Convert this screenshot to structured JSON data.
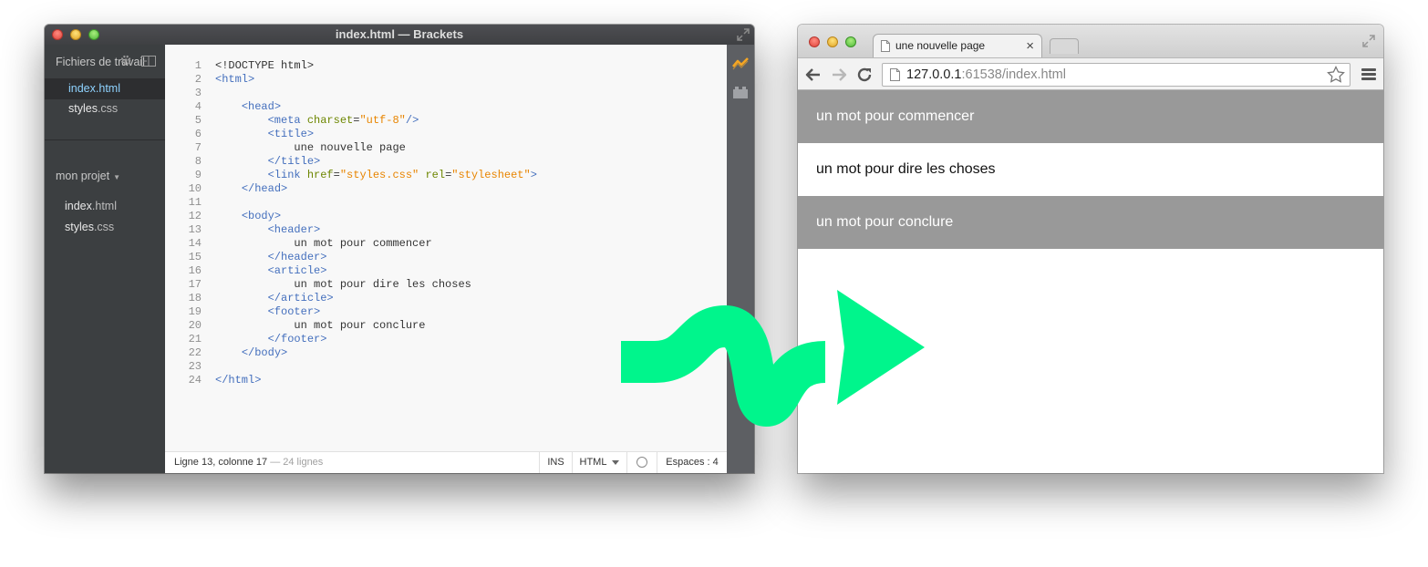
{
  "editor": {
    "title": "index.html — Brackets",
    "sidebar": {
      "working_files_label": "Fichiers de travail",
      "working_files": [
        {
          "name": "index",
          "ext": ".html"
        },
        {
          "name": "styles",
          "ext": ".css"
        }
      ],
      "project_label": "mon projet",
      "project_files": [
        {
          "name": "index",
          "ext": ".html"
        },
        {
          "name": "styles",
          "ext": ".css"
        }
      ]
    },
    "code": {
      "line_numbers": [
        "1",
        "2",
        "3",
        "4",
        "5",
        "6",
        "7",
        "8",
        "9",
        "10",
        "11",
        "12",
        "13",
        "14",
        "15",
        "16",
        "17",
        "18",
        "19",
        "20",
        "21",
        "22",
        "23",
        "24"
      ],
      "doctype": "<!DOCTYPE html>",
      "html_open": "<html>",
      "head_open": "<head>",
      "meta_open": "<meta",
      "charset_attr": "charset",
      "charset_val": "\"utf-8\"",
      "meta_close": "/>",
      "title_open": "<title>",
      "title_text": "une nouvelle page",
      "title_close": "</title>",
      "link_open": "<link",
      "href_attr": "href",
      "href_val": "\"styles.css\"",
      "rel_attr": "rel",
      "rel_val": "\"stylesheet\"",
      "link_close": ">",
      "head_close": "</head>",
      "body_open": "<body>",
      "header_open": "<header>",
      "header_text": "un mot pour commencer",
      "header_close": "</header>",
      "article_open": "<article>",
      "article_text": "un mot pour dire les choses",
      "article_close": "</article>",
      "footer_open": "<footer>",
      "footer_text": "un mot pour conclure",
      "footer_close": "</footer>",
      "body_close": "</body>",
      "html_close": "</html>"
    },
    "status": {
      "position": "Ligne 13, colonne 17",
      "line_count": " — 24 lignes",
      "mode": "INS",
      "language": "HTML",
      "indent": "Espaces : 4"
    }
  },
  "browser": {
    "tab_title": "une nouvelle page",
    "tab_close": "×",
    "url_host": "127.0.0.1",
    "url_rest": ":61538/index.html",
    "page": {
      "header": "un mot pour commencer",
      "article": "un mot pour dire les choses",
      "footer": "un mot pour conclure"
    }
  },
  "colors": {
    "arrow": "#00f58c",
    "page_band": "#999999",
    "editor_bg": "#f8f8f8",
    "sidebar_bg": "#3c3f41",
    "tag": "#446fbd",
    "attr": "#6d8600",
    "string": "#e88501"
  }
}
